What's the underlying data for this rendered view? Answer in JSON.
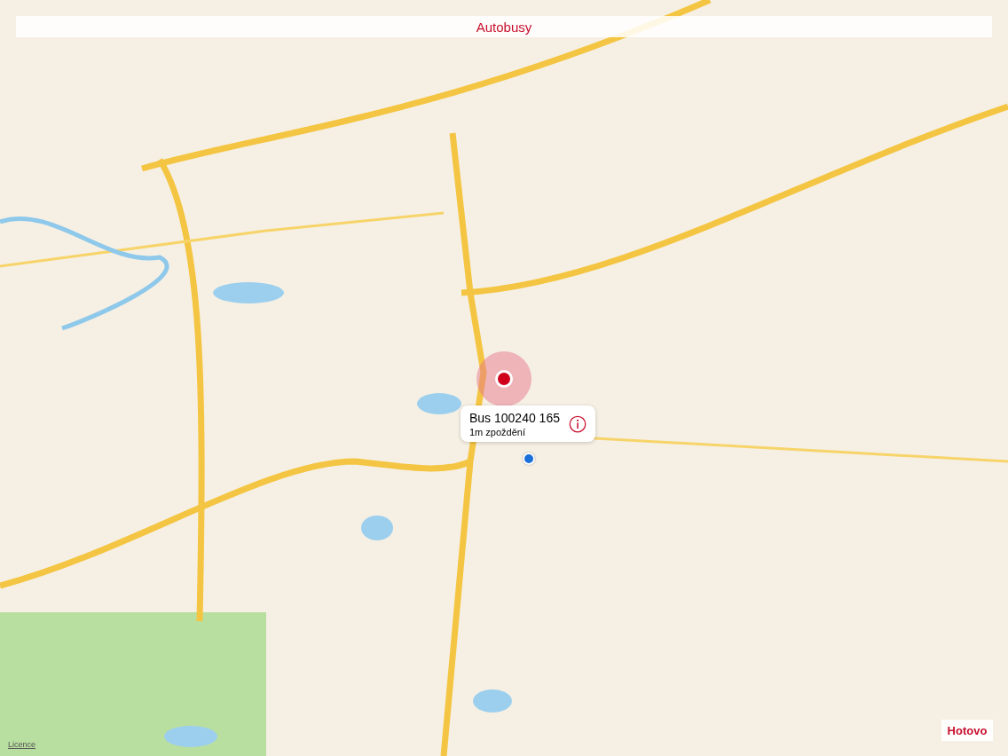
{
  "title": "Autobusy",
  "map": {
    "callout": {
      "title": "Bus 100240 165",
      "subtitle": "1m zpoždění"
    },
    "licence_link": "Licence",
    "done_button": "Hotovo"
  }
}
